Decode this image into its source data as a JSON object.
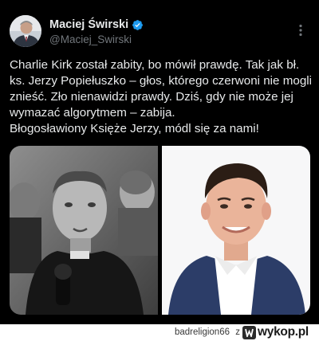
{
  "tweet": {
    "author": {
      "display_name": "Maciej Świrski",
      "handle": "@Maciej_Swirski",
      "verified": true
    },
    "text_lines": [
      "Charlie Kirk został zabity, bo mówił prawdę. Tak jak bł.",
      "ks. Jerzy Popiełuszko – głos, którego czerwoni nie mogli",
      "znieść. Zło nienawidzi prawdy. Dziś, gdy nie może jej",
      "wymazać algorytmem – zabija.",
      "Błogosławiony Księże Jerzy, módl się za nami!"
    ],
    "media": [
      {
        "kind": "photo",
        "style": "black-and-white"
      },
      {
        "kind": "photo",
        "style": "color"
      }
    ]
  },
  "footer": {
    "uploader": "badreligion66",
    "separator": "z",
    "site_logo_text": "wykop.pl"
  },
  "colors": {
    "background": "#000000",
    "text_primary": "#e7e9ea",
    "text_secondary": "#71767b",
    "verified_blue": "#1d9bf0"
  }
}
